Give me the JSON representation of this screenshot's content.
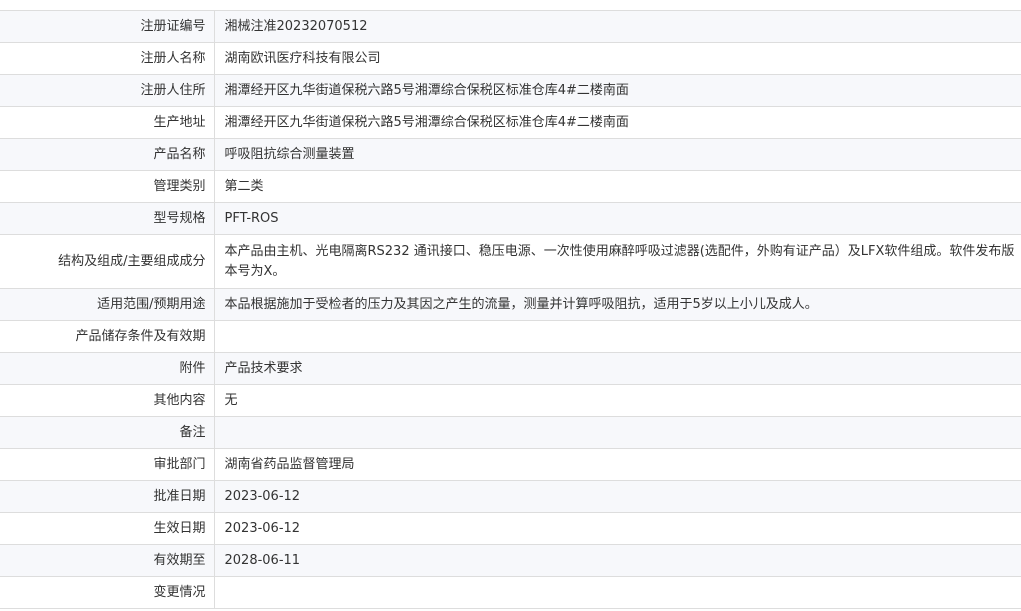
{
  "rows": [
    {
      "label": "注册证编号",
      "value": "湘械注准20232070512"
    },
    {
      "label": "注册人名称",
      "value": "湖南欧讯医疗科技有限公司"
    },
    {
      "label": "注册人住所",
      "value": "湘潭经开区九华街道保税六路5号湘潭综合保税区标准仓库4#二楼南面"
    },
    {
      "label": "生产地址",
      "value": "湘潭经开区九华街道保税六路5号湘潭综合保税区标准仓库4#二楼南面"
    },
    {
      "label": "产品名称",
      "value": "呼吸阻抗综合测量装置"
    },
    {
      "label": "管理类别",
      "value": "第二类"
    },
    {
      "label": "型号规格",
      "value": "PFT-ROS"
    },
    {
      "label": "结构及组成/主要组成成分",
      "value": "本产品由主机、光电隔离RS232 通讯接口、稳压电源、一次性使用麻醉呼吸过滤器(选配件，外购有证产品）及LFX软件组成。软件发布版本号为X。"
    },
    {
      "label": "适用范围/预期用途",
      "value": "本品根据施加于受检者的压力及其因之产生的流量，测量并计算呼吸阻抗，适用于5岁以上小儿及成人。"
    },
    {
      "label": "产品储存条件及有效期",
      "value": ""
    },
    {
      "label": "附件",
      "value": "产品技术要求"
    },
    {
      "label": "其他内容",
      "value": "无"
    },
    {
      "label": "备注",
      "value": ""
    },
    {
      "label": "审批部门",
      "value": "湖南省药品监督管理局"
    },
    {
      "label": "批准日期",
      "value": "2023-06-12"
    },
    {
      "label": "生效日期",
      "value": "2023-06-12"
    },
    {
      "label": "有效期至",
      "value": "2028-06-11"
    },
    {
      "label": "变更情况",
      "value": ""
    }
  ]
}
